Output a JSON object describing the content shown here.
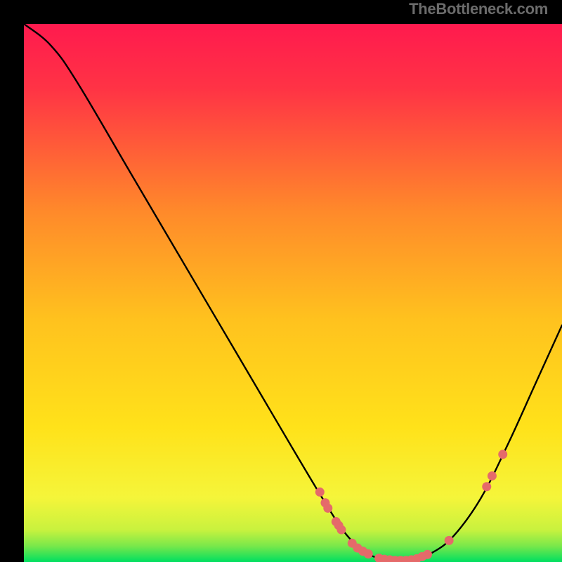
{
  "watermark": "TheBottleneck.com",
  "chart_data": {
    "type": "line",
    "title": "",
    "xlabel": "",
    "ylabel": "",
    "xlim": [
      0,
      100
    ],
    "ylim": [
      0,
      100
    ],
    "background_gradient": {
      "top": "#ff1a4e",
      "mid": "#ffd400",
      "bottom": "#00e060"
    },
    "curve": {
      "description": "V-shaped bottleneck curve, steep drop, rounded minimum near x≈70, rise to right edge",
      "points": [
        {
          "x": 0,
          "y": 100
        },
        {
          "x": 5,
          "y": 96
        },
        {
          "x": 10,
          "y": 89
        },
        {
          "x": 20,
          "y": 72
        },
        {
          "x": 30,
          "y": 55
        },
        {
          "x": 40,
          "y": 38
        },
        {
          "x": 50,
          "y": 21
        },
        {
          "x": 56,
          "y": 11
        },
        {
          "x": 60,
          "y": 5
        },
        {
          "x": 64,
          "y": 1.5
        },
        {
          "x": 68,
          "y": 0.3
        },
        {
          "x": 72,
          "y": 0.3
        },
        {
          "x": 76,
          "y": 1.8
        },
        {
          "x": 80,
          "y": 5
        },
        {
          "x": 85,
          "y": 12
        },
        {
          "x": 90,
          "y": 22
        },
        {
          "x": 95,
          "y": 33
        },
        {
          "x": 100,
          "y": 44
        }
      ]
    },
    "markers": {
      "color": "#e56a6a",
      "points": [
        {
          "x": 55,
          "y": 13
        },
        {
          "x": 56,
          "y": 11
        },
        {
          "x": 56.5,
          "y": 10
        },
        {
          "x": 58,
          "y": 7.5
        },
        {
          "x": 58.5,
          "y": 6.8
        },
        {
          "x": 59,
          "y": 6
        },
        {
          "x": 61,
          "y": 3.5
        },
        {
          "x": 62,
          "y": 2.6
        },
        {
          "x": 63,
          "y": 2.0
        },
        {
          "x": 64,
          "y": 1.5
        },
        {
          "x": 66,
          "y": 0.7
        },
        {
          "x": 67,
          "y": 0.5
        },
        {
          "x": 68,
          "y": 0.4
        },
        {
          "x": 69,
          "y": 0.3
        },
        {
          "x": 70,
          "y": 0.3
        },
        {
          "x": 71,
          "y": 0.3
        },
        {
          "x": 72,
          "y": 0.4
        },
        {
          "x": 73,
          "y": 0.6
        },
        {
          "x": 74,
          "y": 1.0
        },
        {
          "x": 75,
          "y": 1.4
        },
        {
          "x": 79,
          "y": 4
        },
        {
          "x": 86,
          "y": 14
        },
        {
          "x": 87,
          "y": 16
        },
        {
          "x": 89,
          "y": 20
        }
      ]
    }
  }
}
